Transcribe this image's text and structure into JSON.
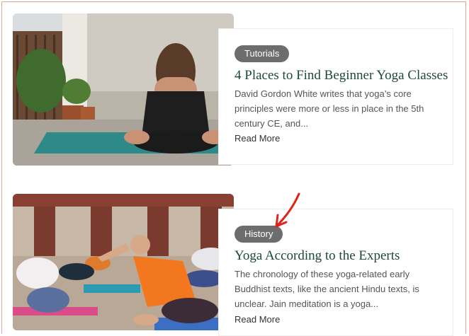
{
  "posts": [
    {
      "category": "Tutorials",
      "title": "4 Places to Find Beginner Yoga Classes",
      "excerpt": "David Gordon White writes that yoga’s core principles were more or less in place in the 5th century CE, and...",
      "read_more": "Read More"
    },
    {
      "category": "History",
      "title": "Yoga According to the Experts",
      "excerpt": "The chronology of these yoga-related early Buddhist texts, like the ancient Hindu texts, is unclear. Jain meditation is a yoga...",
      "read_more": "Read More"
    }
  ],
  "annotation": {
    "arrow_color": "#e0231c"
  },
  "colors": {
    "badge_bg": "#6d6d6d",
    "title": "#1e4a35",
    "frame_border": "#eaa58e"
  }
}
